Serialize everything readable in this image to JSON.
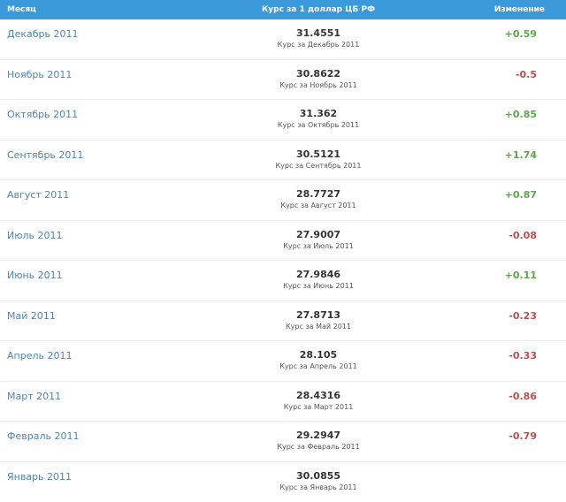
{
  "header": {
    "month": "Месяц",
    "rate": "Курс за 1 доллар ЦБ РФ",
    "change": "Изменение"
  },
  "colors": {
    "header_bg": "#3a9ad9",
    "link": "#4c86b4",
    "positive": "#5ba84b",
    "negative": "#b85050"
  },
  "rows": [
    {
      "month": "Декабрь 2011",
      "rate": "31.4551",
      "subtitle": "Курс за Декабрь 2011",
      "change": "+0.59",
      "dir": "pos"
    },
    {
      "month": "Ноябрь 2011",
      "rate": "30.8622",
      "subtitle": "Курс за Ноябрь 2011",
      "change": "-0.5",
      "dir": "neg"
    },
    {
      "month": "Октябрь 2011",
      "rate": "31.362",
      "subtitle": "Курс за Октябрь 2011",
      "change": "+0.85",
      "dir": "pos"
    },
    {
      "month": "Сентябрь 2011",
      "rate": "30.5121",
      "subtitle": "Курс за Сентябрь 2011",
      "change": "+1.74",
      "dir": "pos"
    },
    {
      "month": "Август 2011",
      "rate": "28.7727",
      "subtitle": "Курс за Август 2011",
      "change": "+0.87",
      "dir": "pos"
    },
    {
      "month": "Июль 2011",
      "rate": "27.9007",
      "subtitle": "Курс за Июль 2011",
      "change": "-0.08",
      "dir": "neg"
    },
    {
      "month": "Июнь 2011",
      "rate": "27.9846",
      "subtitle": "Курс за Июнь 2011",
      "change": "+0.11",
      "dir": "pos"
    },
    {
      "month": "Май 2011",
      "rate": "27.8713",
      "subtitle": "Курс за Май 2011",
      "change": "-0.23",
      "dir": "neg"
    },
    {
      "month": "Апрель 2011",
      "rate": "28.105",
      "subtitle": "Курс за Апрель 2011",
      "change": "-0.33",
      "dir": "neg"
    },
    {
      "month": "Март 2011",
      "rate": "28.4316",
      "subtitle": "Курс за Март 2011",
      "change": "-0.86",
      "dir": "neg"
    },
    {
      "month": "Февраль 2011",
      "rate": "29.2947",
      "subtitle": "Курс за Февраль 2011",
      "change": "-0.79",
      "dir": "neg"
    },
    {
      "month": "Январь 2011",
      "rate": "30.0855",
      "subtitle": "Курс за Январь 2011",
      "change": "",
      "dir": "pos"
    }
  ]
}
